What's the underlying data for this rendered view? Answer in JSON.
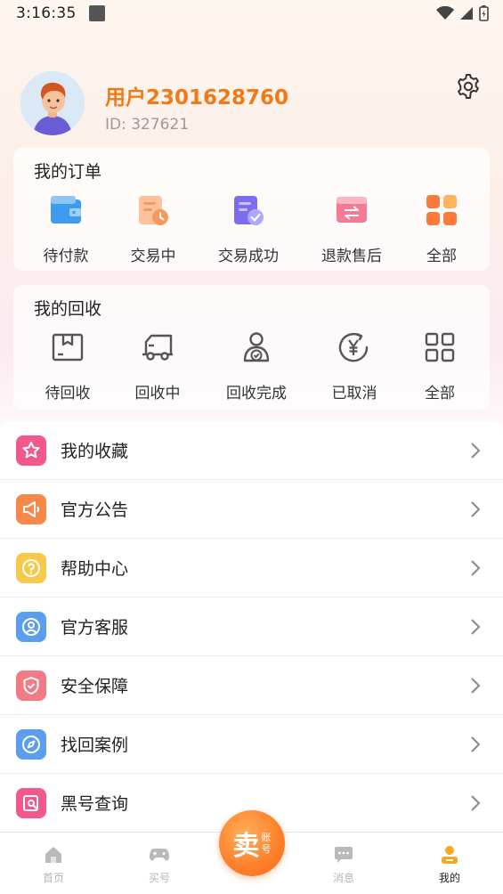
{
  "status_bar": {
    "time": "3:16:35"
  },
  "profile": {
    "username": "用户2301628760",
    "user_id": "ID: 327621"
  },
  "orders": {
    "title": "我的订单",
    "items": [
      {
        "label": "待付款",
        "icon": "wallet-icon",
        "color": "#3d9bf0"
      },
      {
        "label": "交易中",
        "icon": "order-clock-icon",
        "color": "#f59a5c"
      },
      {
        "label": "交易成功",
        "icon": "order-check-icon",
        "color": "#7b6cf0"
      },
      {
        "label": "退款售后",
        "icon": "refund-icon",
        "color": "#f57a94"
      },
      {
        "label": "全部",
        "icon": "grid-icon",
        "color": "#fa7a3a"
      }
    ]
  },
  "recycle": {
    "title": "我的回收",
    "items": [
      {
        "label": "待回收",
        "icon": "box-icon"
      },
      {
        "label": "回收中",
        "icon": "truck-icon"
      },
      {
        "label": "回收完成",
        "icon": "user-check-icon"
      },
      {
        "label": "已取消",
        "icon": "yen-cancel-icon"
      },
      {
        "label": "全部",
        "icon": "grid-outline-icon"
      }
    ]
  },
  "menu": [
    {
      "label": "我的收藏",
      "icon": "star-icon",
      "color": "#f0598a"
    },
    {
      "label": "官方公告",
      "icon": "megaphone-icon",
      "color": "#f5894a"
    },
    {
      "label": "帮助中心",
      "icon": "question-icon",
      "color": "#f7c94a"
    },
    {
      "label": "官方客服",
      "icon": "service-icon",
      "color": "#5b9ef0"
    },
    {
      "label": "安全保障",
      "icon": "shield-icon",
      "color": "#f27a85"
    },
    {
      "label": "找回案例",
      "icon": "compass-icon",
      "color": "#5b9ef0"
    },
    {
      "label": "黑号查询",
      "icon": "search-doc-icon",
      "color": "#f0598a"
    }
  ],
  "bottom_nav": {
    "items": [
      {
        "label": "首页",
        "icon": "home-icon"
      },
      {
        "label": "买号",
        "icon": "gamepad-icon"
      },
      {
        "label": "消息",
        "icon": "message-icon"
      },
      {
        "label": "我的",
        "icon": "profile-icon"
      }
    ],
    "sell": {
      "main": "卖",
      "sub1": "账",
      "sub2": "号"
    }
  },
  "colors": {
    "brand_orange": "#f07a16",
    "active_nav": "#f5a623"
  }
}
